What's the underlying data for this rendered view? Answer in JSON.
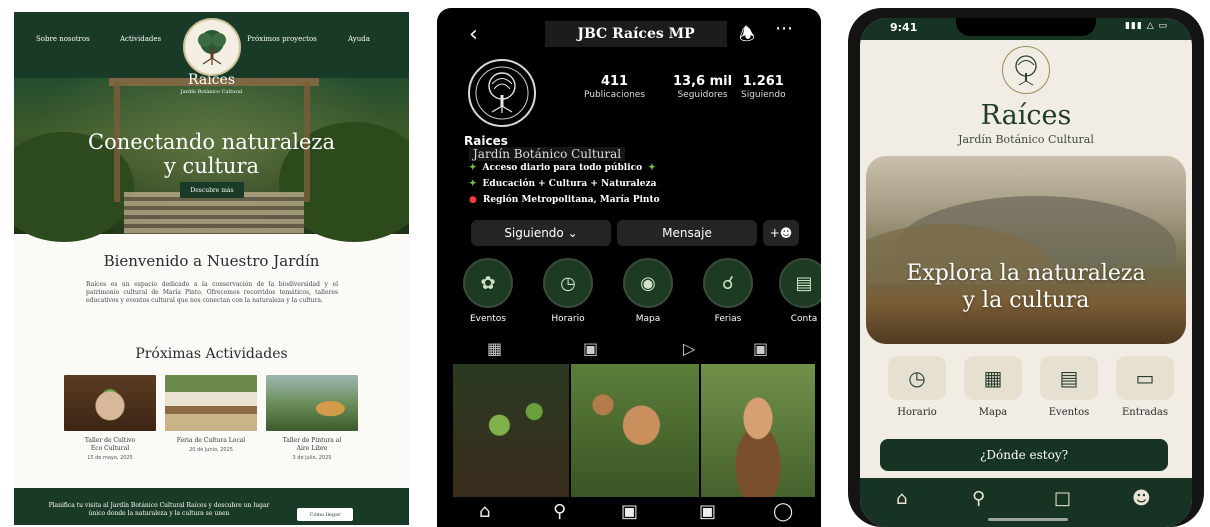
{
  "web": {
    "nav": [
      "Sobre nosotros",
      "Actividades",
      "Próximos proyectos",
      "Ayuda"
    ],
    "brand_title": "Raíces",
    "brand_subtitle": "Jardín Botánico Cultural",
    "hero_line1": "Conectando naturaleza",
    "hero_line2": "y cultura",
    "hero_button": "Descubre más",
    "welcome_title": "Bienvenido a Nuestro Jardín",
    "welcome_text": "Raíces es un espacio dedicado a la conservación de la biodiversidad y el patrimonio cultural de María Pinto. Ofrecemos recorridos temáticos, talleres educativos y eventos cultural que nos conectan con la naturaleza y la cultura.",
    "activities_title": "Próximas Actividades",
    "activities": [
      {
        "line1": "Taller de Cultivo",
        "line2": "Eco Cultural",
        "date": "15 de mayo, 2025"
      },
      {
        "line1": "Feria de Cultura Local",
        "line2": "",
        "date": "20 de junio, 2025"
      },
      {
        "line1": "Taller de Pintura al",
        "line2": "Aire Libre",
        "date": "3 de julio, 2025"
      }
    ],
    "footer_text": "Planifica tu visita al Jardín Botánico Cultural Raíces y descubre un lugar único donde la naturaleza y la cultura se unen",
    "footer_button": "Cómo llegar"
  },
  "ig": {
    "username": "JBC Raíces MP",
    "stats": [
      {
        "value": "411",
        "label": "Publicaciones"
      },
      {
        "value": "13,6 mil",
        "label": "Seguidores"
      },
      {
        "value": "1.261",
        "label": "Siguiendo"
      }
    ],
    "bio_name": "Raices",
    "bio_subtitle": "Jardín Botánico Cultural",
    "bio_lines": [
      "Acceso diario para todo público",
      "Educación + Cultura + Naturaleza",
      "Región Metropolitana, María Pinto"
    ],
    "btn_follow": "Siguiendo",
    "btn_message": "Mensaje",
    "highlights": [
      "Eventos",
      "Horario",
      "Mapa",
      "Ferias",
      "Conta"
    ]
  },
  "app": {
    "time": "9:41",
    "title": "Raíces",
    "subtitle": "Jardín Botánico Cultural",
    "banner_line1": "Explora la naturaleza",
    "banner_line2": "y la cultura",
    "tiles": [
      "Horario",
      "Mapa",
      "Eventos",
      "Entradas"
    ],
    "where_button": "¿Dónde estoy?"
  },
  "colors": {
    "forest": "#183a27",
    "cream": "#f1ede4",
    "ig_bg": "#000000"
  }
}
